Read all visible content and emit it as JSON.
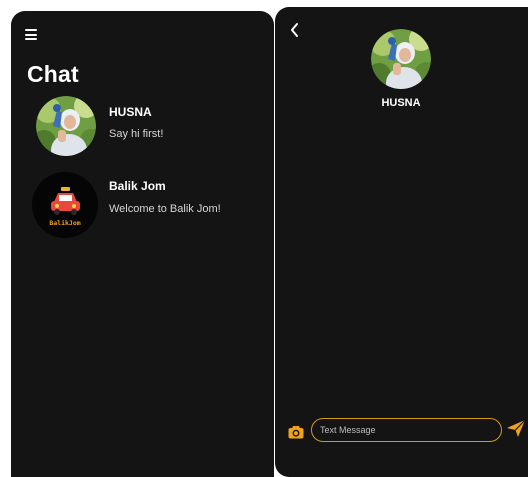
{
  "list": {
    "title": "Chat",
    "icons": {
      "menu": "hamburger-menu-icon"
    },
    "chats": [
      {
        "name": "HUSNA",
        "preview": "Say hi first!",
        "avatar": "user-photo"
      },
      {
        "name": "Balik Jom",
        "preview": "Welcome to Balik Jom!",
        "avatar": "balik-jom-logo",
        "logo_text": "BalikJom"
      }
    ]
  },
  "conversation": {
    "contact_name": "HUSNA",
    "input": {
      "placeholder": "Text Message",
      "value": ""
    },
    "icons": {
      "back": "chevron-left-icon",
      "camera": "camera-icon",
      "send": "paper-plane-icon"
    }
  },
  "colors": {
    "panel_bg": "#141414",
    "accent": "#f0a21f",
    "input_border": "#d39a17",
    "text_primary": "#ffffff",
    "text_secondary": "#d6d6d6"
  }
}
